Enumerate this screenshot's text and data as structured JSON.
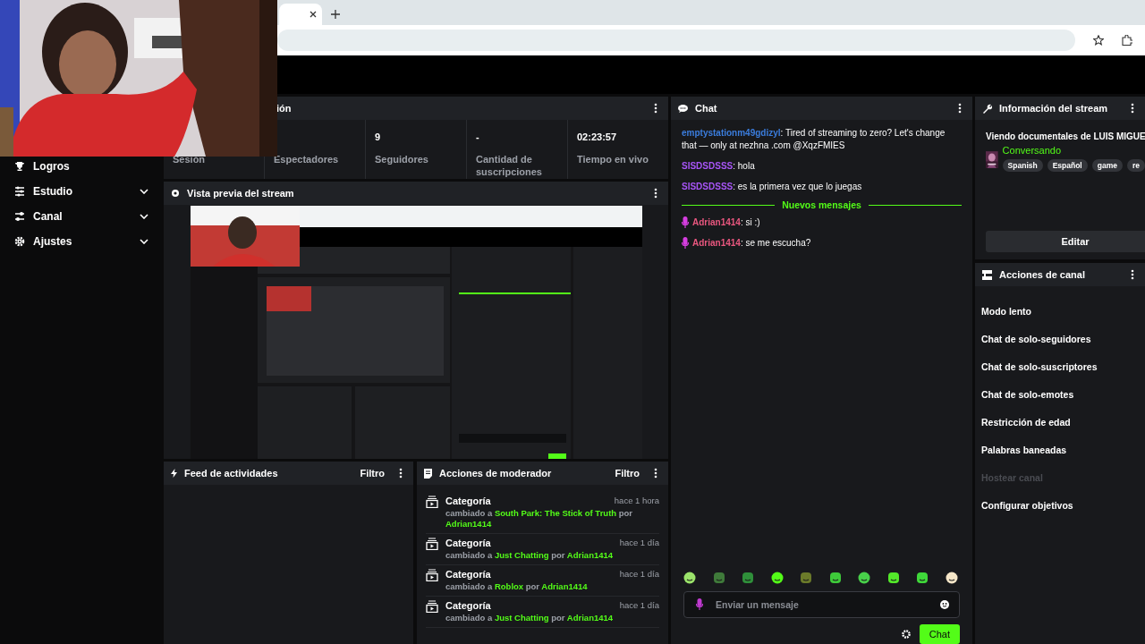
{
  "sidebar": {
    "items": [
      {
        "label": "Logros",
        "expandable": false
      },
      {
        "label": "Estudio",
        "expandable": true
      },
      {
        "label": "Canal",
        "expandable": true
      },
      {
        "label": "Ajustes",
        "expandable": true
      }
    ]
  },
  "session_panel": {
    "title": "ión",
    "stats": [
      {
        "label": "Sesión"
      },
      {
        "label": "Espectadores"
      },
      {
        "value": "9",
        "label": "Seguidores"
      },
      {
        "value": "-",
        "label": "Cantidad de suscripciones"
      },
      {
        "value": "02:23:57",
        "label": "Tiempo en vivo"
      }
    ]
  },
  "preview_panel": {
    "title": "Vista previa del stream"
  },
  "activity_feed": {
    "title": "Feed de actividades",
    "filter": "Filtro"
  },
  "mod_actions": {
    "title": "Acciones de moderador",
    "filter": "Filtro",
    "entries": [
      {
        "title": "Categoría",
        "time": "hace 1 hora",
        "detail": [
          {
            "text": "cambiado a ",
            "highlight": false
          },
          {
            "text": "South Park: The Stick of Truth",
            "highlight": true
          },
          {
            "text": " por ",
            "highlight": false
          },
          {
            "text": "Adrian1414",
            "highlight": true
          }
        ]
      },
      {
        "title": "Categoría",
        "time": "hace 1 día",
        "detail": [
          {
            "text": "cambiado a ",
            "highlight": false
          },
          {
            "text": "Just Chatting",
            "highlight": true
          },
          {
            "text": " por ",
            "highlight": false
          },
          {
            "text": "Adrian1414",
            "highlight": true
          }
        ]
      },
      {
        "title": "Categoría",
        "time": "hace 1 día",
        "detail": [
          {
            "text": "cambiado a ",
            "highlight": false
          },
          {
            "text": "Roblox",
            "highlight": true
          },
          {
            "text": " por ",
            "highlight": false
          },
          {
            "text": "Adrian1414",
            "highlight": true
          }
        ]
      },
      {
        "title": "Categoría",
        "time": "hace 1 día",
        "detail": [
          {
            "text": "cambiado a ",
            "highlight": false
          },
          {
            "text": "Just Chatting",
            "highlight": true
          },
          {
            "text": " por ",
            "highlight": false
          },
          {
            "text": "Adrian1414",
            "highlight": true
          }
        ]
      }
    ]
  },
  "chat": {
    "title": "Chat",
    "messages": [
      {
        "kind": "message",
        "user": "emptystationm49gdizyl",
        "color": "#3b7ddd",
        "mic_badge": false,
        "text": ": Tired of streaming to zero? Let's change that — only at nezhna .com @XqzFMIES"
      },
      {
        "kind": "message",
        "user": "SISDSDSSS",
        "color": "#a855f7",
        "mic_badge": false,
        "text": ": hola"
      },
      {
        "kind": "message",
        "user": "SISDSDSSS",
        "color": "#a855f7",
        "mic_badge": false,
        "text": ": es la primera vez que lo juegas"
      },
      {
        "kind": "divider",
        "text": "Nuevos mensajes"
      },
      {
        "kind": "message",
        "user": "Adrian1414",
        "color": "#e9577f",
        "mic_badge": true,
        "text": ": si :)"
      },
      {
        "kind": "message",
        "user": "Adrian1414",
        "color": "#e9577f",
        "mic_badge": true,
        "text": ": se me escucha?"
      }
    ],
    "input": {
      "placeholder": "Enviar un mensaje"
    },
    "send_button": "Chat"
  },
  "stream_info": {
    "title": "Información del stream",
    "stream_title": "Viendo documentales de LUIS MIGUE",
    "category": "Conversando",
    "tags": [
      "Spanish",
      "Español",
      "game",
      "re"
    ],
    "edit_button": "Editar"
  },
  "channel_actions": {
    "title": "Acciones de canal",
    "items": [
      {
        "label": "Modo lento",
        "disabled": false
      },
      {
        "label": "Chat de solo-seguidores",
        "disabled": false
      },
      {
        "label": "Chat de solo-suscriptores",
        "disabled": false
      },
      {
        "label": "Chat de solo-emotes",
        "disabled": false
      },
      {
        "label": "Restricción de edad",
        "disabled": false
      },
      {
        "label": "Palabras baneadas",
        "disabled": false
      },
      {
        "label": "Hostear canal",
        "disabled": true
      },
      {
        "label": "Configurar objetivos",
        "disabled": false
      }
    ]
  }
}
